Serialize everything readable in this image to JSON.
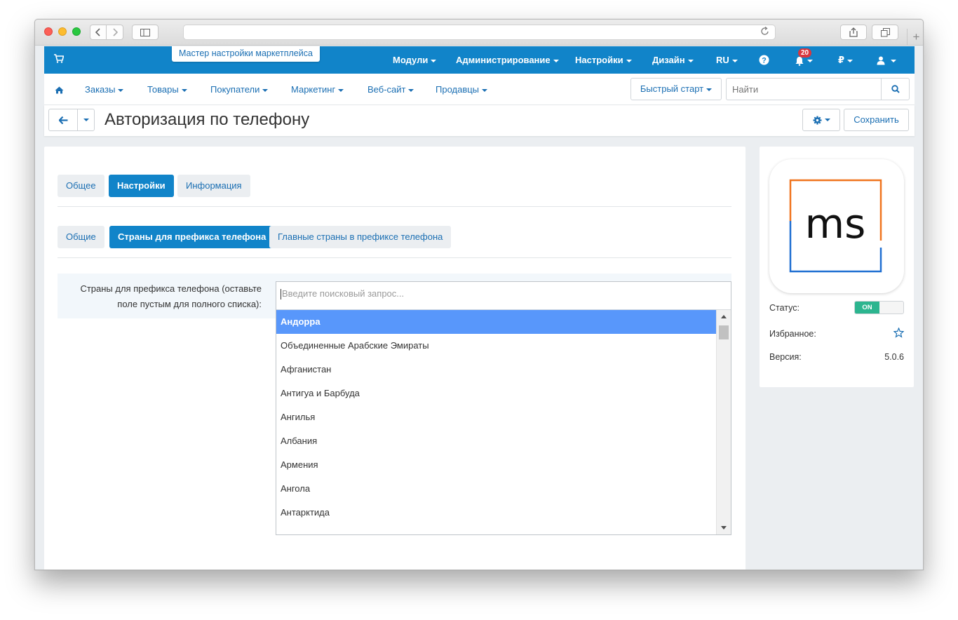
{
  "browser": {
    "url": "",
    "icons": [
      "back-icon",
      "forward-icon",
      "sidebar-icon",
      "reload-icon",
      "share-icon",
      "tabs-icon",
      "new-tab-icon"
    ]
  },
  "topbar": {
    "wizard_label": "Мастер настройки маркетплейса",
    "menu": [
      "Модули",
      "Администрирование",
      "Настройки",
      "Дизайн",
      "RU"
    ],
    "notification_count": "20",
    "accent": "#1184c9"
  },
  "navbar": {
    "items": [
      "Заказы",
      "Товары",
      "Покупатели",
      "Маркетинг",
      "Веб-сайт",
      "Продавцы"
    ],
    "quick_start": "Быстрый старт",
    "search_placeholder": "Найти"
  },
  "page": {
    "title": "Авторизация по телефону",
    "save_label": "Сохранить"
  },
  "tabs_main": [
    {
      "label": "Общее",
      "active": false
    },
    {
      "label": "Настройки",
      "active": true
    },
    {
      "label": "Информация",
      "active": false
    }
  ],
  "tabs_sub": [
    {
      "label": "Общие",
      "active": false
    },
    {
      "label": "Страны для префикса телефона",
      "active": true
    },
    {
      "label": "Главные страны в префиксе телефона",
      "active": false
    }
  ],
  "field": {
    "label_line1": "Страны для префикса телефона (оставьте",
    "label_line2": "поле пустым для полного списка):",
    "search_placeholder": "Введите поисковый запрос...",
    "options": [
      "Андорра",
      "Объединенные Арабские Эмираты",
      "Афганистан",
      "Антигуа и Барбуда",
      "Ангилья",
      "Албания",
      "Армения",
      "Ангола",
      "Антарктида"
    ],
    "selected_index": 0
  },
  "side": {
    "logo_text": "ms",
    "status_label": "Статус:",
    "status_value": "ON",
    "favorite_label": "Избранное:",
    "version_label": "Версия:",
    "version_value": "5.0.6"
  }
}
